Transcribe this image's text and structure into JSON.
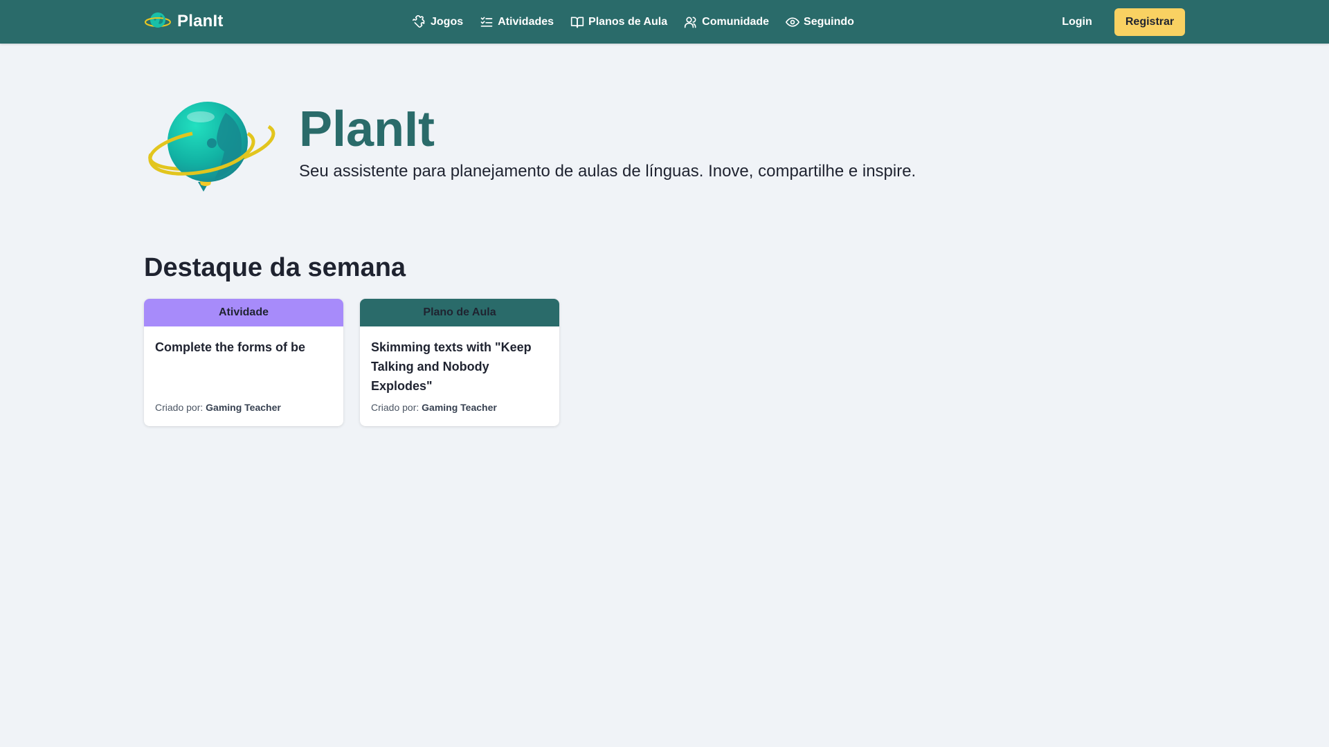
{
  "navbar": {
    "brand": "PlanIt",
    "links": [
      {
        "label": "Jogos",
        "icon": "puzzle-icon"
      },
      {
        "label": "Atividades",
        "icon": "checklist-icon"
      },
      {
        "label": "Planos de Aula",
        "icon": "book-icon"
      },
      {
        "label": "Comunidade",
        "icon": "users-icon"
      },
      {
        "label": "Seguindo",
        "icon": "eye-icon"
      }
    ],
    "login": "Login",
    "register": "Registrar"
  },
  "hero": {
    "title": "PlanIt",
    "subtitle": "Seu assistente para planejamento de aulas de línguas. Inove, compartilhe e inspire."
  },
  "featured": {
    "title": "Destaque da semana",
    "cards": [
      {
        "type": "Atividade",
        "title": "Complete the forms of be",
        "created_by_label": "Criado por:",
        "author": "Gaming Teacher"
      },
      {
        "type": "Plano de Aula",
        "title": "Skimming texts with \"Keep Talking and Nobody Explodes\"",
        "created_by_label": "Criado por:",
        "author": "Gaming Teacher"
      }
    ]
  },
  "colors": {
    "primary": "#2a6b6a",
    "accent": "#f9d162",
    "activity": "#a78bfa",
    "background": "#f0f3f7"
  }
}
